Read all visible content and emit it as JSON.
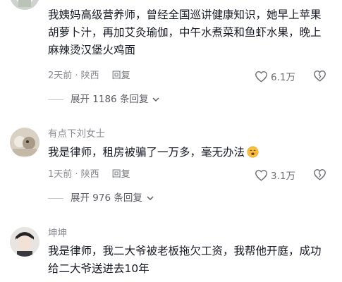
{
  "comments": [
    {
      "username": "",
      "text": "我姨妈高级营养师，曾经全国巡讲健康知识，她早上苹果胡萝卜汁，再加艾灸瑜伽，中午水煮菜和鱼虾水果，晚上麻辣烫汉堡火鸡面",
      "time_location": "2天前 · 陕西",
      "reply_label": "回复",
      "likes": "6.1万",
      "expand_label": "展开 1186 条回复"
    },
    {
      "username": "有点下刘女士",
      "text": "我是律师，租房被骗了一万多，毫无办法",
      "time_location": "1天前 · 陕西",
      "reply_label": "回复",
      "likes": "3.1万",
      "expand_label": "展开 976 条回复"
    },
    {
      "username": "坤坤",
      "text": "我是律师，我二大爷被老板拖欠工资，我帮他开庭，成功给二大爷送进去10年"
    }
  ],
  "icons": {
    "like": "heart-outline-icon",
    "dislike": "broken-heart-icon",
    "expand": "chevron-down-icon",
    "emoji": "smiling-face-emoji"
  },
  "colors": {
    "text": "#161823",
    "meta": "#8a8b91",
    "divider": "#c9cacd"
  }
}
